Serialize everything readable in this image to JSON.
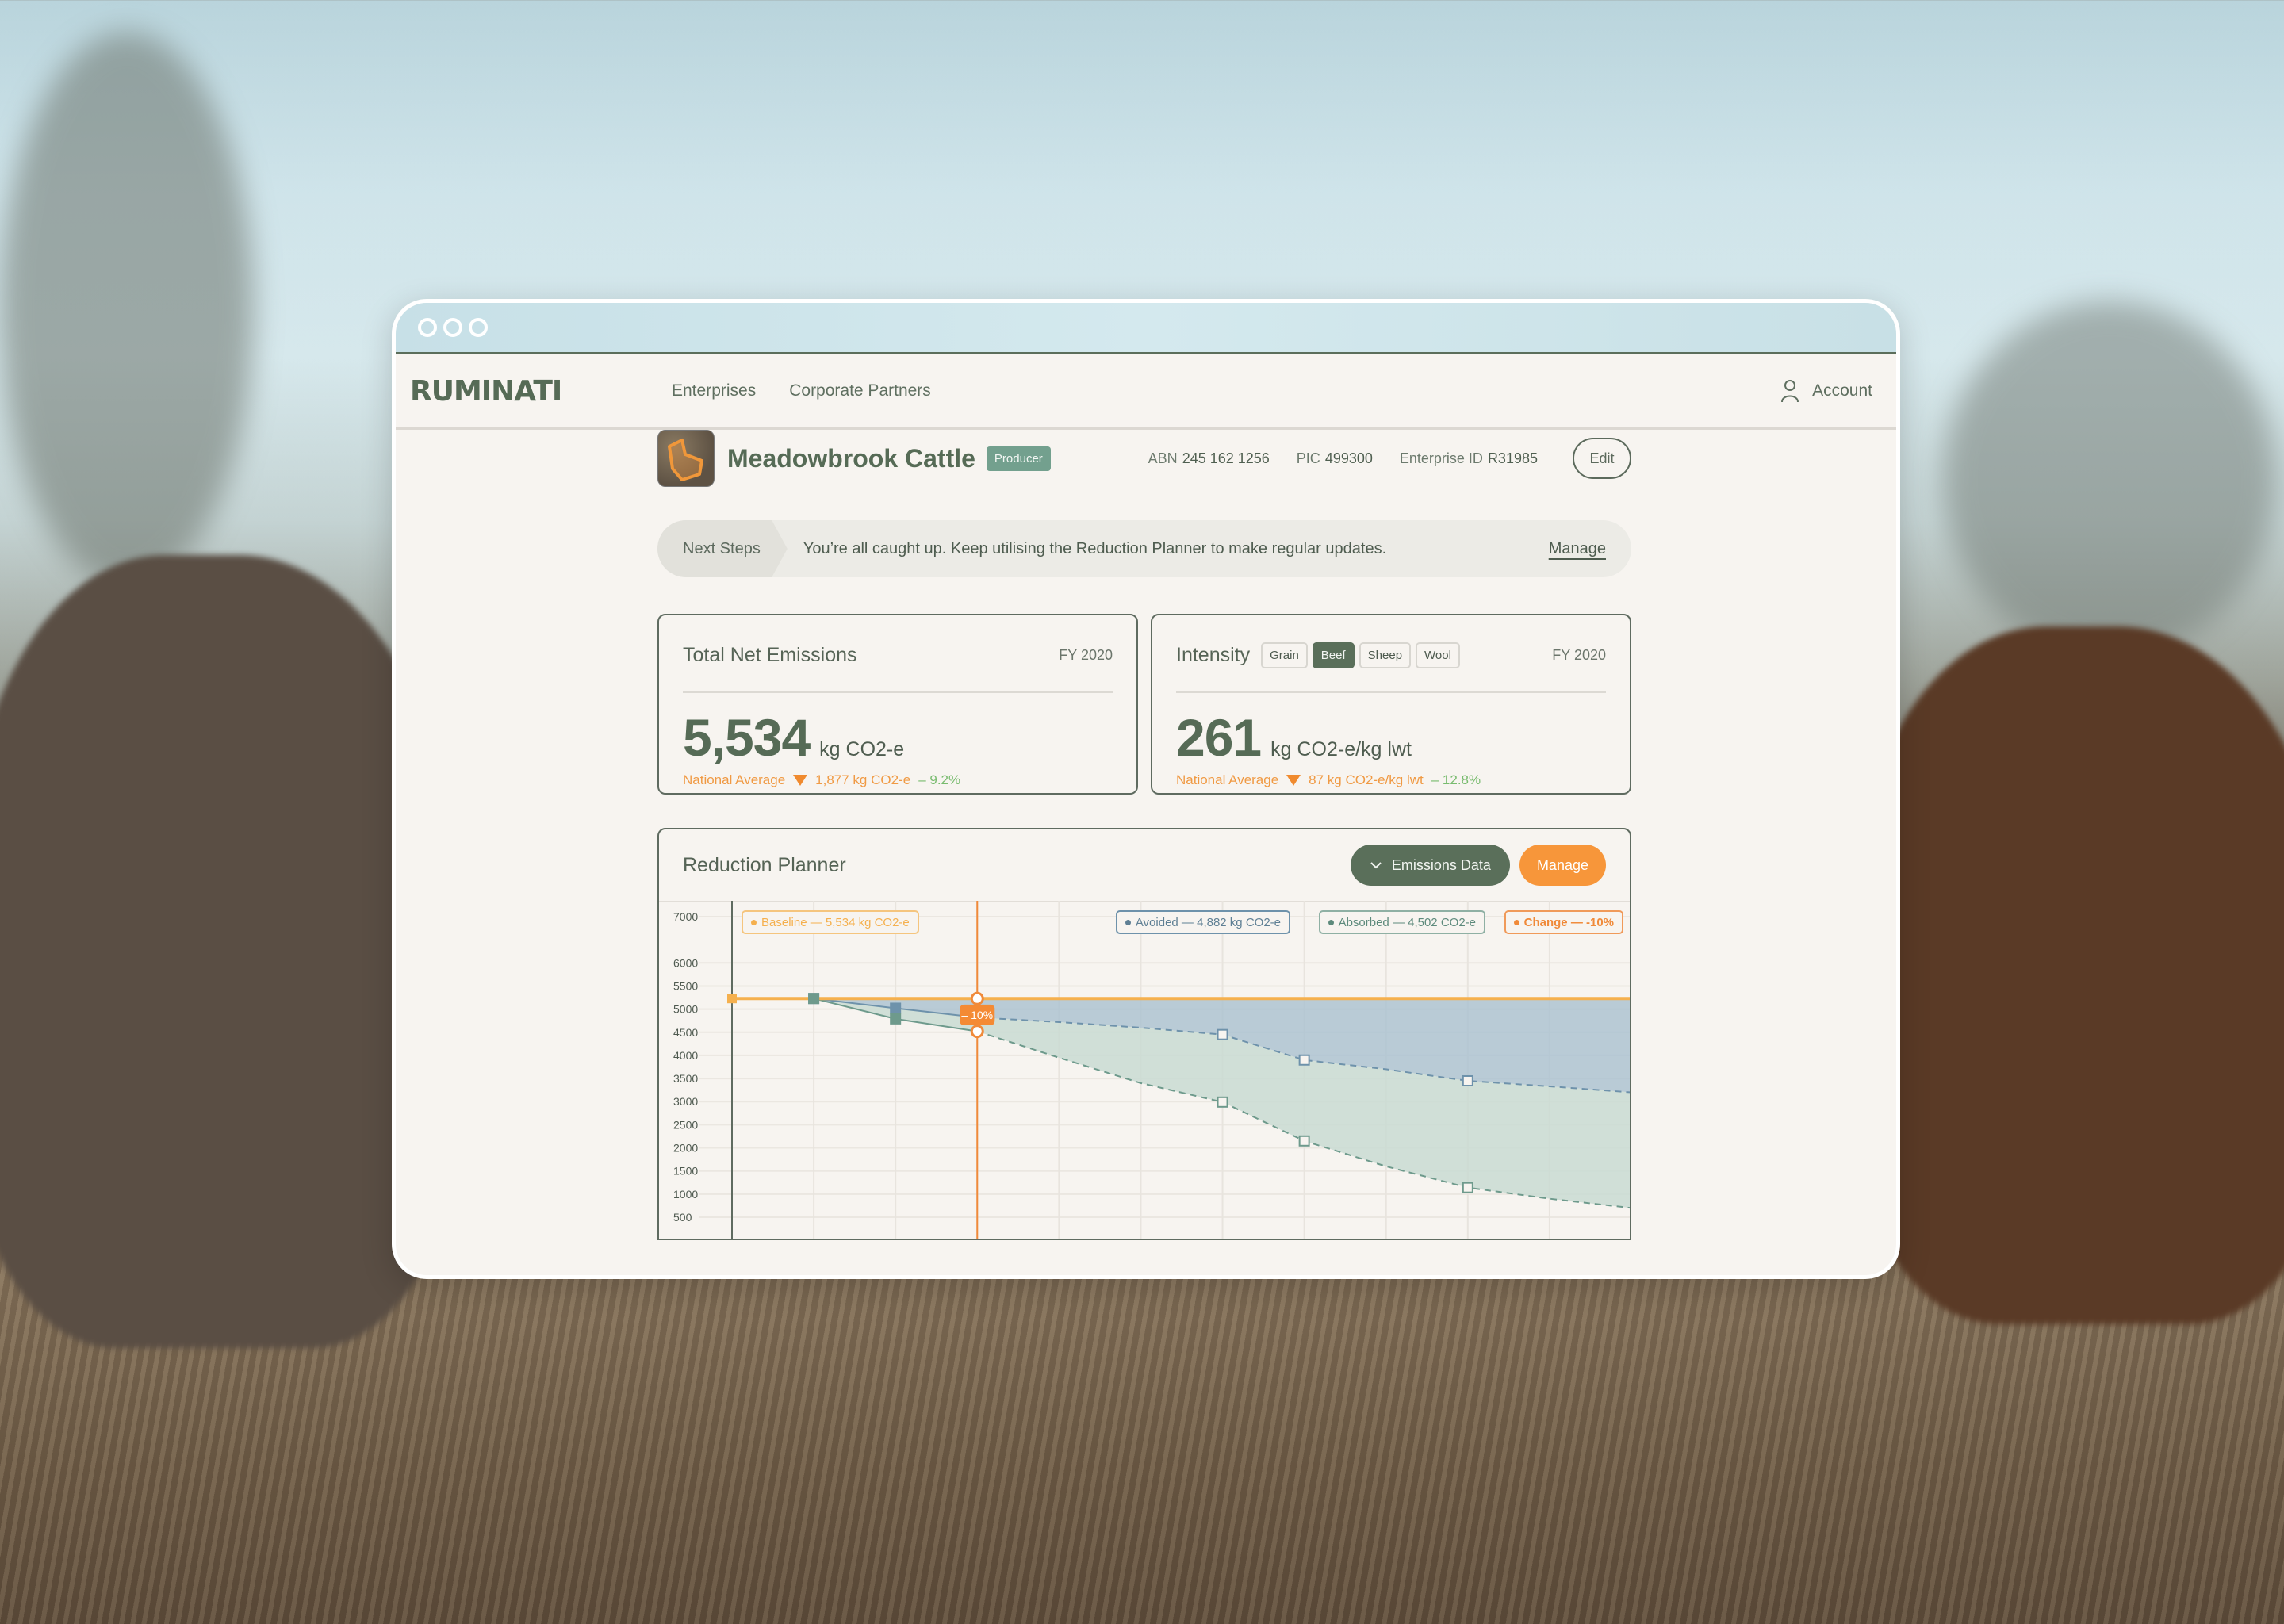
{
  "window": {
    "controls": [
      "window-dot",
      "window-dot",
      "window-dot"
    ]
  },
  "nav": {
    "logo": "RUMINATI",
    "links": [
      "Enterprises",
      "Corporate Partners"
    ],
    "account_label": "Account",
    "account_icon": "user-icon"
  },
  "enterprise": {
    "name": "Meadowbrook Cattle",
    "badge": "Producer",
    "abn_label": "ABN",
    "abn": "245 162 1256",
    "pic_label": "PIC",
    "pic": "499300",
    "eid_label": "Enterprise ID",
    "eid": "R31985",
    "edit_label": "Edit"
  },
  "next_steps": {
    "label": "Next Steps",
    "message": "You’re all caught up. Keep utilising the Reduction Planner to make regular updates.",
    "action": "Manage"
  },
  "emissions_card": {
    "title": "Total Net Emissions",
    "period": "FY 2020",
    "value": "5,534",
    "unit": "kg CO2-e",
    "national_label": "National Average",
    "national_value": "1,877 kg CO2-e",
    "change": "– 9.2%"
  },
  "intensity_card": {
    "title": "Intensity",
    "period": "FY 2020",
    "tabs": [
      {
        "label": "Grain",
        "active": false
      },
      {
        "label": "Beef",
        "active": true
      },
      {
        "label": "Sheep",
        "active": false
      },
      {
        "label": "Wool",
        "active": false
      }
    ],
    "value": "261",
    "unit": "kg CO2-e/kg lwt",
    "national_label": "National Average",
    "national_value": "87 kg CO2-e/kg lwt",
    "change": "– 12.8%"
  },
  "planner": {
    "title": "Reduction Planner",
    "emissions_button": "Emissions Data",
    "manage_button": "Manage"
  },
  "colors": {
    "brand_green": "#566b56",
    "accent_orange": "#f7963a",
    "baseline": "#f5b04e",
    "avoided": "#6e92ab",
    "absorbed": "#6e9a8c",
    "positive": "#78bb6e"
  },
  "chart_data": {
    "type": "area",
    "title": "Reduction Planner",
    "xlabel": "",
    "ylabel": "",
    "ylim": [
      500,
      7000
    ],
    "yticks": [
      7000,
      6000,
      5500,
      5000,
      4500,
      4000,
      3500,
      3000,
      2500,
      2000,
      1500,
      1000,
      500
    ],
    "x": [
      0,
      1,
      2,
      3,
      4,
      5,
      6,
      7,
      8,
      9,
      10,
      11
    ],
    "grid": true,
    "legend": [
      {
        "label": "Baseline",
        "value": "5,534 kg CO2-e",
        "color": "#f5b04e"
      },
      {
        "label": "Avoided",
        "value": "4,882 kg CO2-e",
        "color": "#6e92ab"
      },
      {
        "label": "Absorbed",
        "value": "4,502 CO2-e",
        "color": "#6e9a8c"
      },
      {
        "label": "Change",
        "value": "-10%",
        "color": "#f08a3a"
      }
    ],
    "series": [
      {
        "name": "Baseline",
        "values": [
          5230,
          5230,
          5230,
          5230,
          5230,
          5230,
          5230,
          5230,
          5230,
          5230,
          5230,
          5230
        ]
      },
      {
        "name": "Avoided",
        "values": [
          null,
          5230,
          5020,
          4820,
          4720,
          4600,
          4450,
          3900,
          3700,
          3450,
          3330,
          3200
        ],
        "markers": [
          1,
          2,
          6,
          7,
          9
        ]
      },
      {
        "name": "Absorbed",
        "values": [
          null,
          5230,
          4790,
          4520,
          3950,
          3400,
          2990,
          2150,
          1600,
          1140,
          900,
          700
        ],
        "markers": [
          1,
          2,
          6,
          7,
          9
        ]
      }
    ],
    "solid_until_index": 3,
    "marker_index": 3,
    "marker_label": "– 10%"
  }
}
